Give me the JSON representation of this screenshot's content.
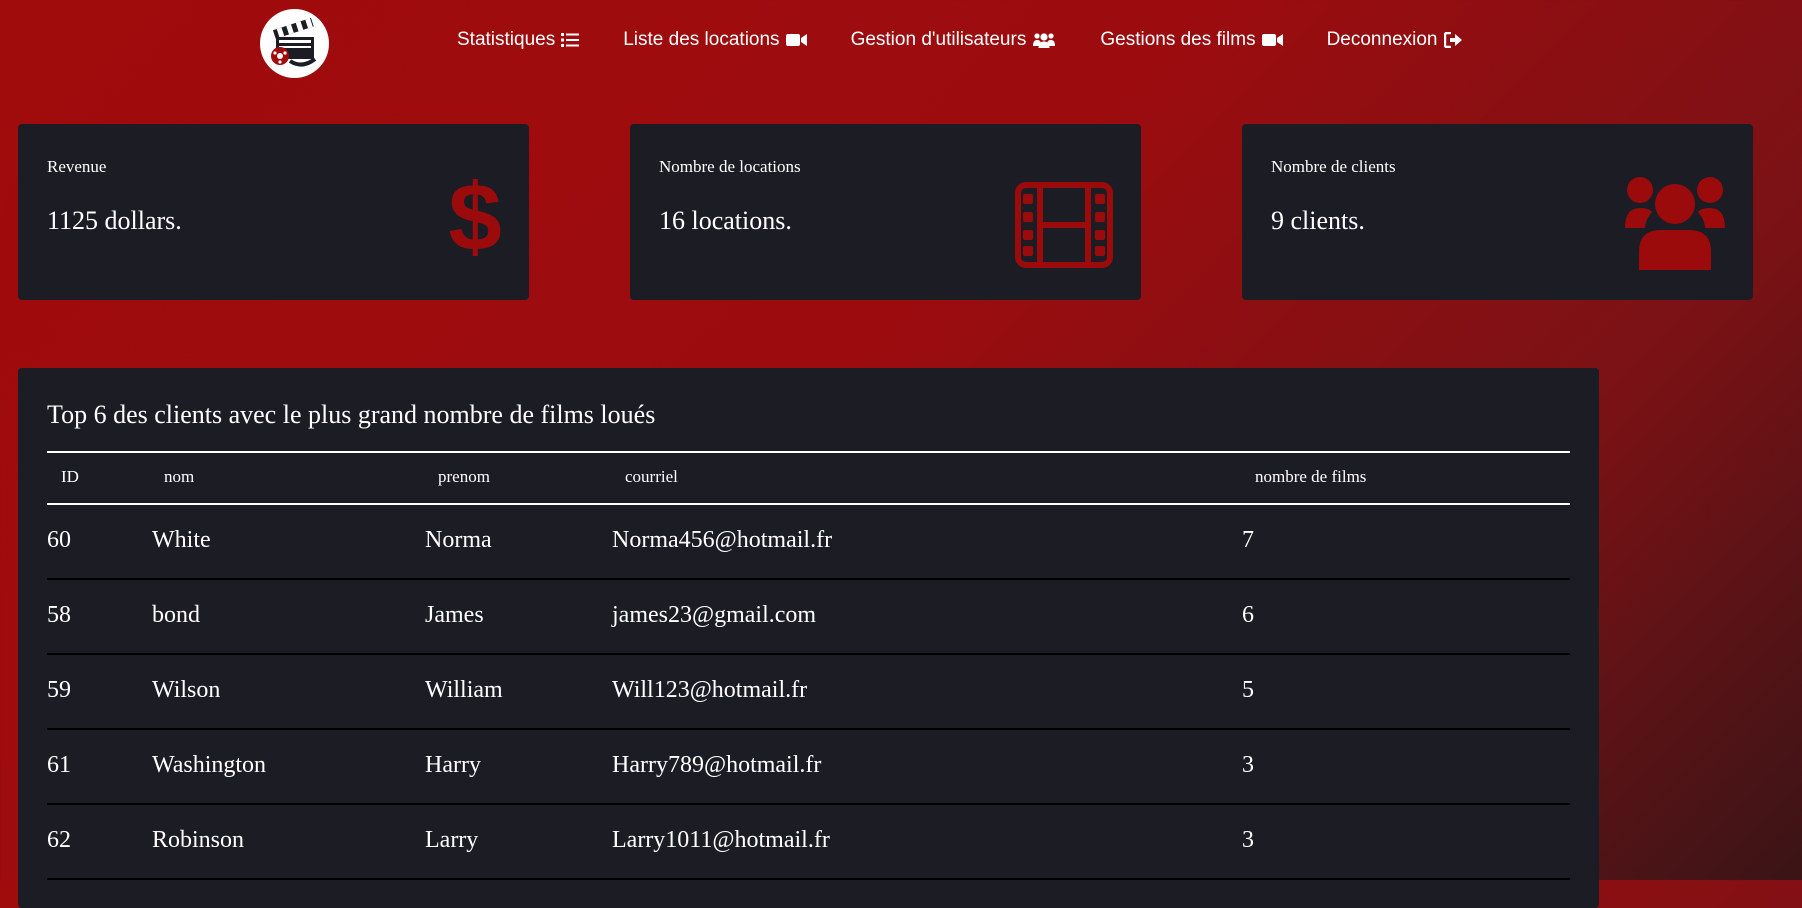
{
  "nav": {
    "items": [
      {
        "label": "Statistiques",
        "icon": "list-icon"
      },
      {
        "label": "Liste des locations",
        "icon": "video-camera-icon"
      },
      {
        "label": "Gestion d'utilisateurs",
        "icon": "users-icon"
      },
      {
        "label": "Gestions des films",
        "icon": "video-camera-icon"
      },
      {
        "label": "Deconnexion",
        "icon": "sign-out-icon"
      }
    ]
  },
  "stats": {
    "revenue": {
      "label": "Revenue",
      "value": "1125 dollars.",
      "icon": "dollar-icon"
    },
    "locations": {
      "label": "Nombre de locations",
      "value": "16 locations.",
      "icon": "film-icon"
    },
    "clients": {
      "label": "Nombre de clients",
      "value": "9 clients.",
      "icon": "users-icon"
    }
  },
  "top_clients": {
    "title": "Top 6 des clients avec le plus grand nombre de films loués",
    "headers": {
      "id": "ID",
      "nom": "nom",
      "prenom": "prenom",
      "courriel": "courriel",
      "nombre": "nombre de films"
    },
    "rows": [
      {
        "id": "60",
        "nom": "White",
        "prenom": "Norma",
        "courriel": "Norma456@hotmail.fr",
        "nombre": "7"
      },
      {
        "id": "58",
        "nom": "bond",
        "prenom": "James",
        "courriel": "james23@gmail.com",
        "nombre": "6"
      },
      {
        "id": "59",
        "nom": "Wilson",
        "prenom": "William",
        "courriel": "Will123@hotmail.fr",
        "nombre": "5"
      },
      {
        "id": "61",
        "nom": "Washington",
        "prenom": "Harry",
        "courriel": "Harry789@hotmail.fr",
        "nombre": "3"
      },
      {
        "id": "62",
        "nom": "Robinson",
        "prenom": "Larry",
        "courriel": "Larry1011@hotmail.fr",
        "nombre": "3"
      }
    ]
  },
  "colors": {
    "accent": "#a00b0b",
    "card_bg": "#1b1c24",
    "icon_red": "#9c0b0b"
  }
}
